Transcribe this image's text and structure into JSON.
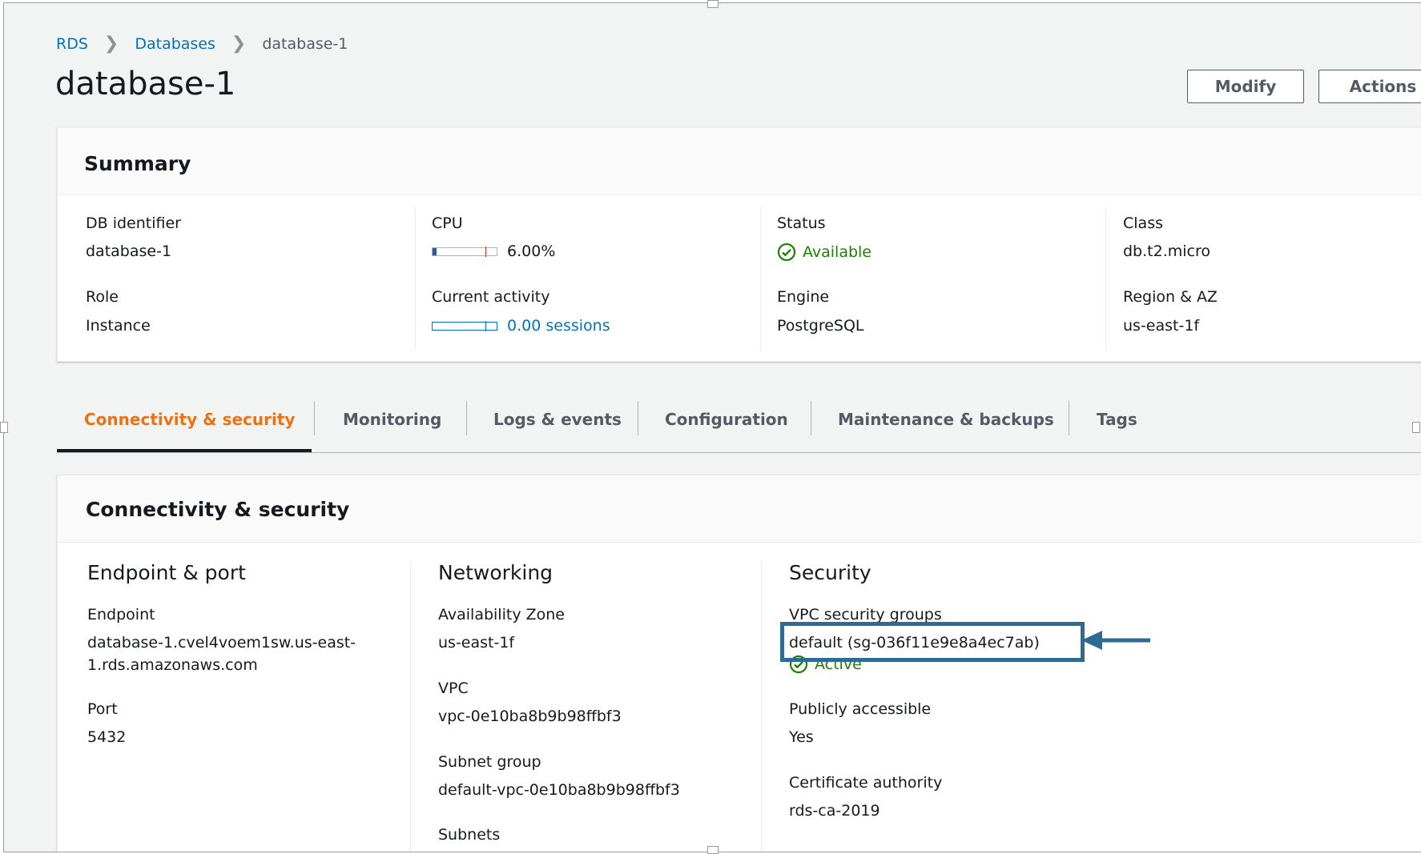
{
  "breadcrumb": {
    "root": "RDS",
    "databases": "Databases",
    "current": "database-1"
  },
  "page": {
    "title": "database-1"
  },
  "toolbar": {
    "modify_label": "Modify",
    "actions_label": "Actions"
  },
  "summary": {
    "title": "Summary",
    "db_identifier": {
      "label": "DB identifier",
      "value": "database-1"
    },
    "role": {
      "label": "Role",
      "value": "Instance"
    },
    "cpu": {
      "label": "CPU",
      "value": "6.00%",
      "fraction": 0.06
    },
    "current_activity": {
      "label": "Current activity",
      "value": "0.00 sessions",
      "fraction": 0.0
    },
    "status": {
      "label": "Status",
      "value": "Available"
    },
    "engine": {
      "label": "Engine",
      "value": "PostgreSQL"
    },
    "class": {
      "label": "Class",
      "value": "db.t2.micro"
    },
    "region": {
      "label": "Region & AZ",
      "value": "us-east-1f"
    }
  },
  "tabs": [
    {
      "label": "Connectivity & security",
      "active": true
    },
    {
      "label": "Monitoring"
    },
    {
      "label": "Logs & events"
    },
    {
      "label": "Configuration"
    },
    {
      "label": "Maintenance & backups"
    },
    {
      "label": "Tags"
    }
  ],
  "connectivity": {
    "title": "Connectivity & security",
    "endpoint_port": {
      "heading": "Endpoint & port",
      "endpoint_label": "Endpoint",
      "endpoint_line1": "database-1.cvel4voem1sw.us-east-",
      "endpoint_line2": "1.rds.amazonaws.com",
      "port_label": "Port",
      "port_value": "5432"
    },
    "networking": {
      "heading": "Networking",
      "az_label": "Availability Zone",
      "az_value": "us-east-1f",
      "vpc_label": "VPC",
      "vpc_value": "vpc-0e10ba8b9b98ffbf3",
      "subnet_group_label": "Subnet group",
      "subnet_group_value": "default-vpc-0e10ba8b9b98ffbf3",
      "subnets_label": "Subnets"
    },
    "security": {
      "heading": "Security",
      "sg_label": "VPC security groups",
      "sg_value": "default (sg-036f11e9e8a4ec7ab)",
      "sg_status": "Active",
      "public_label": "Publicly accessible",
      "public_value": "Yes",
      "ca_label": "Certificate authority",
      "ca_value": "rds-ca-2019"
    }
  },
  "colors": {
    "link": "#0073bb",
    "accent": "#ec7211",
    "success": "#1d8102",
    "annotation": "#2e6b92"
  }
}
